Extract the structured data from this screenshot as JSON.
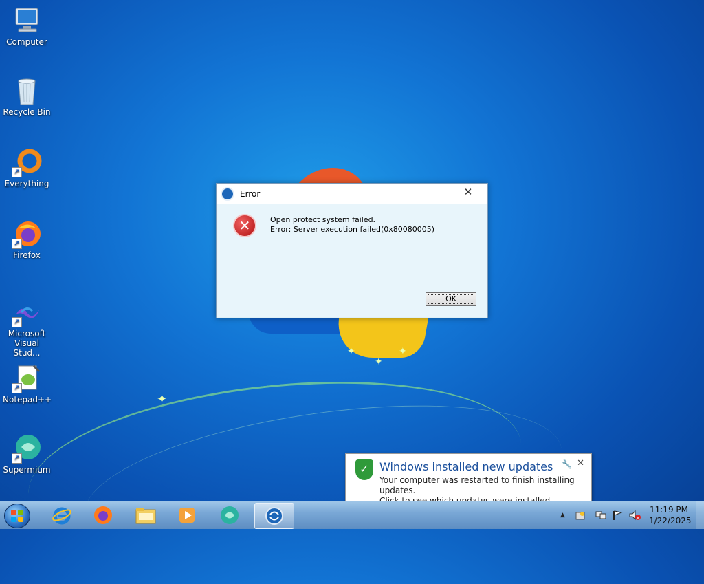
{
  "desktop": {
    "icons": [
      {
        "label": "Computer",
        "icon": "computer-icon"
      },
      {
        "label": "Recycle Bin",
        "icon": "recycle-bin-icon"
      },
      {
        "label": "Everything",
        "icon": "everything-icon"
      },
      {
        "label": "Firefox",
        "icon": "firefox-icon"
      },
      {
        "label": "Microsoft Visual Stud...",
        "icon": "visual-studio-icon"
      },
      {
        "label": "Notepad++",
        "icon": "notepadpp-icon"
      },
      {
        "label": "Supermium",
        "icon": "supermium-icon"
      }
    ]
  },
  "dialog": {
    "title": "Error",
    "close_glyph": "✕",
    "message_line1": "Open protect system failed.",
    "message_line2": "Error: Server execution failed(0x80080005)",
    "ok_label": "OK",
    "icon": "error-icon"
  },
  "notification": {
    "title": "Windows installed new updates",
    "line1": "Your computer was restarted to finish installing updates.",
    "line2": "Click to see which updates were installed.",
    "options_glyph": "🔧",
    "close_glyph": "✕",
    "icon": "shield-icon"
  },
  "taskbar": {
    "pinned": [
      "internet-explorer-icon",
      "firefox-icon",
      "file-explorer-icon",
      "media-player-icon",
      "supermium-icon",
      "app-running-icon"
    ],
    "tray_arrow": "▲",
    "clock_time": "11:19 PM",
    "clock_date": "1/22/2025"
  },
  "colors": {
    "desktop_bg": "#1274d4",
    "error_red": "#c41818",
    "balloon_title": "#1a4f9c"
  }
}
